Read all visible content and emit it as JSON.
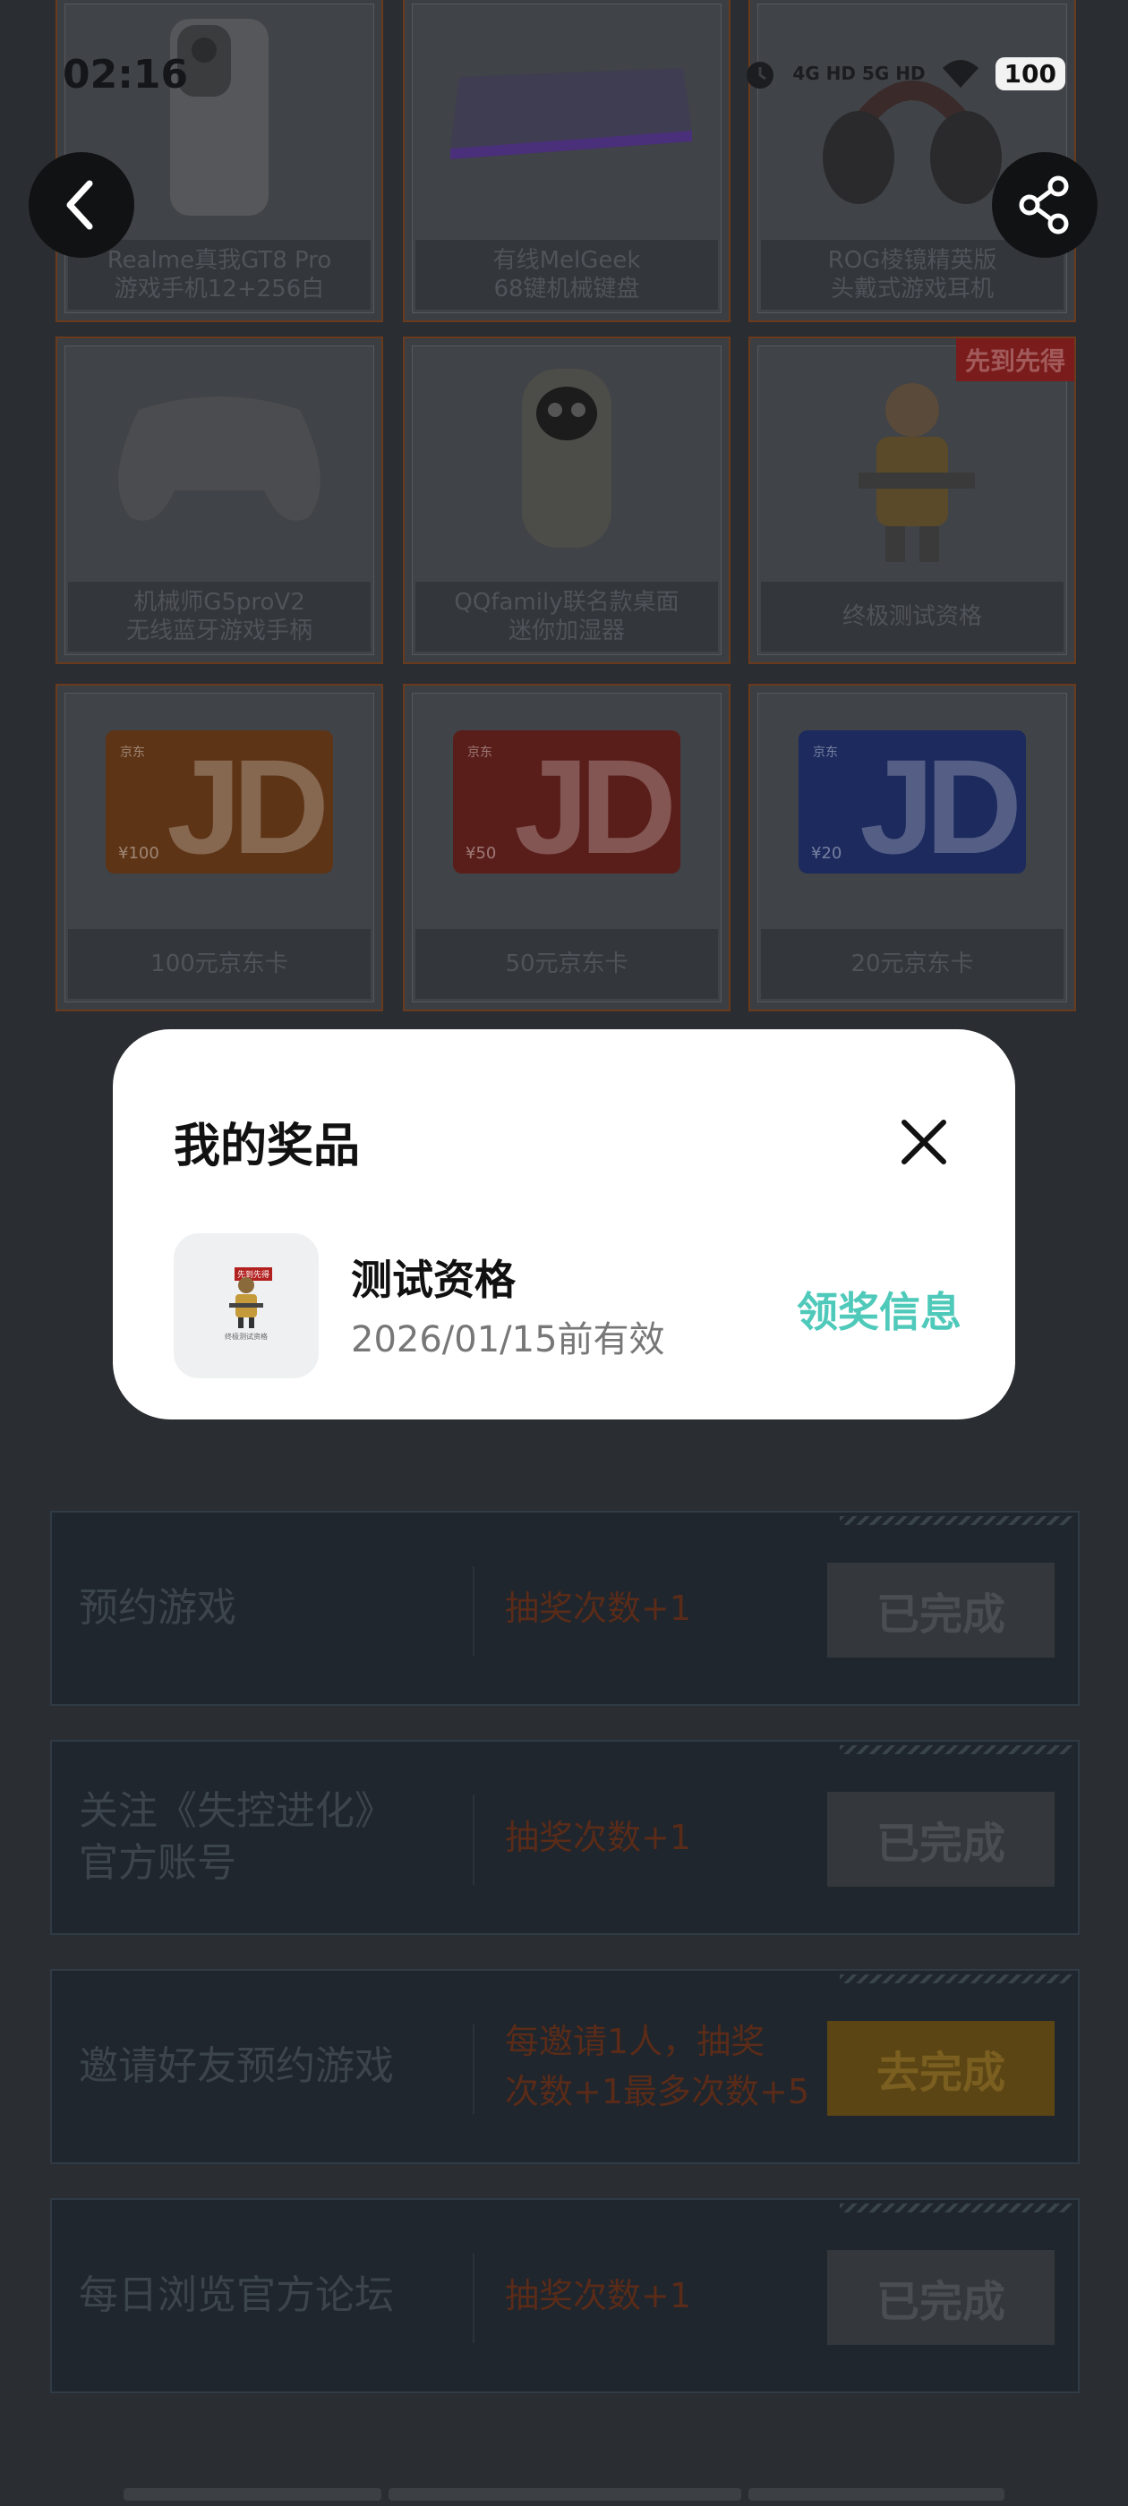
{
  "status_bar": {
    "time": "02:16",
    "network": "4G HD 5G HD",
    "battery": "100"
  },
  "prizes": [
    {
      "name": "Realme真我GT8 Pro\n游戏手机12+256白"
    },
    {
      "name": "有线MelGeek\n68键机械键盘"
    },
    {
      "name": "ROG棱镜精英版\n头戴式游戏耳机"
    },
    {
      "name": "机械师G5proV2\n无线蓝牙游戏手柄"
    },
    {
      "name": "QQfamily联名款桌面\n迷你加湿器"
    },
    {
      "name": "终极测试资格",
      "badge": "先到先得"
    },
    {
      "name": "100元京东卡",
      "card_amount": "¥100",
      "card_color": "#e0601c"
    },
    {
      "name": "50元京东卡",
      "card_amount": "¥50",
      "card_color": "#d42e25"
    },
    {
      "name": "20元京东卡",
      "card_amount": "¥20",
      "card_color": "#1f48c9"
    }
  ],
  "tasks": [
    {
      "name": "预约游戏",
      "reward": "抽奖次数+1",
      "button": "已完成"
    },
    {
      "name": "关注《失控进化》\n官方账号",
      "reward": "抽奖次数+1",
      "button": "已完成"
    },
    {
      "name": "邀请好友预约游戏",
      "reward": "每邀请1人，抽奖\n次数+1最多次数+5",
      "button": "去完成"
    },
    {
      "name": "每日浏览官方论坛",
      "reward": "抽奖次数+1",
      "button": "已完成"
    }
  ],
  "modal": {
    "title": "我的奖品",
    "item": {
      "name": "测试资格",
      "expiry": "2026/01/15前有效",
      "thumb_tag": "先到先得",
      "thumb_caption": "终极测试资格"
    },
    "claim_label": "领奖信息"
  },
  "icons": {
    "back": "chevron-left-icon",
    "share": "share-icon",
    "close": "close-icon"
  },
  "colors": {
    "accent": "#4fc9ba",
    "modal_bg": "#ffffff"
  }
}
